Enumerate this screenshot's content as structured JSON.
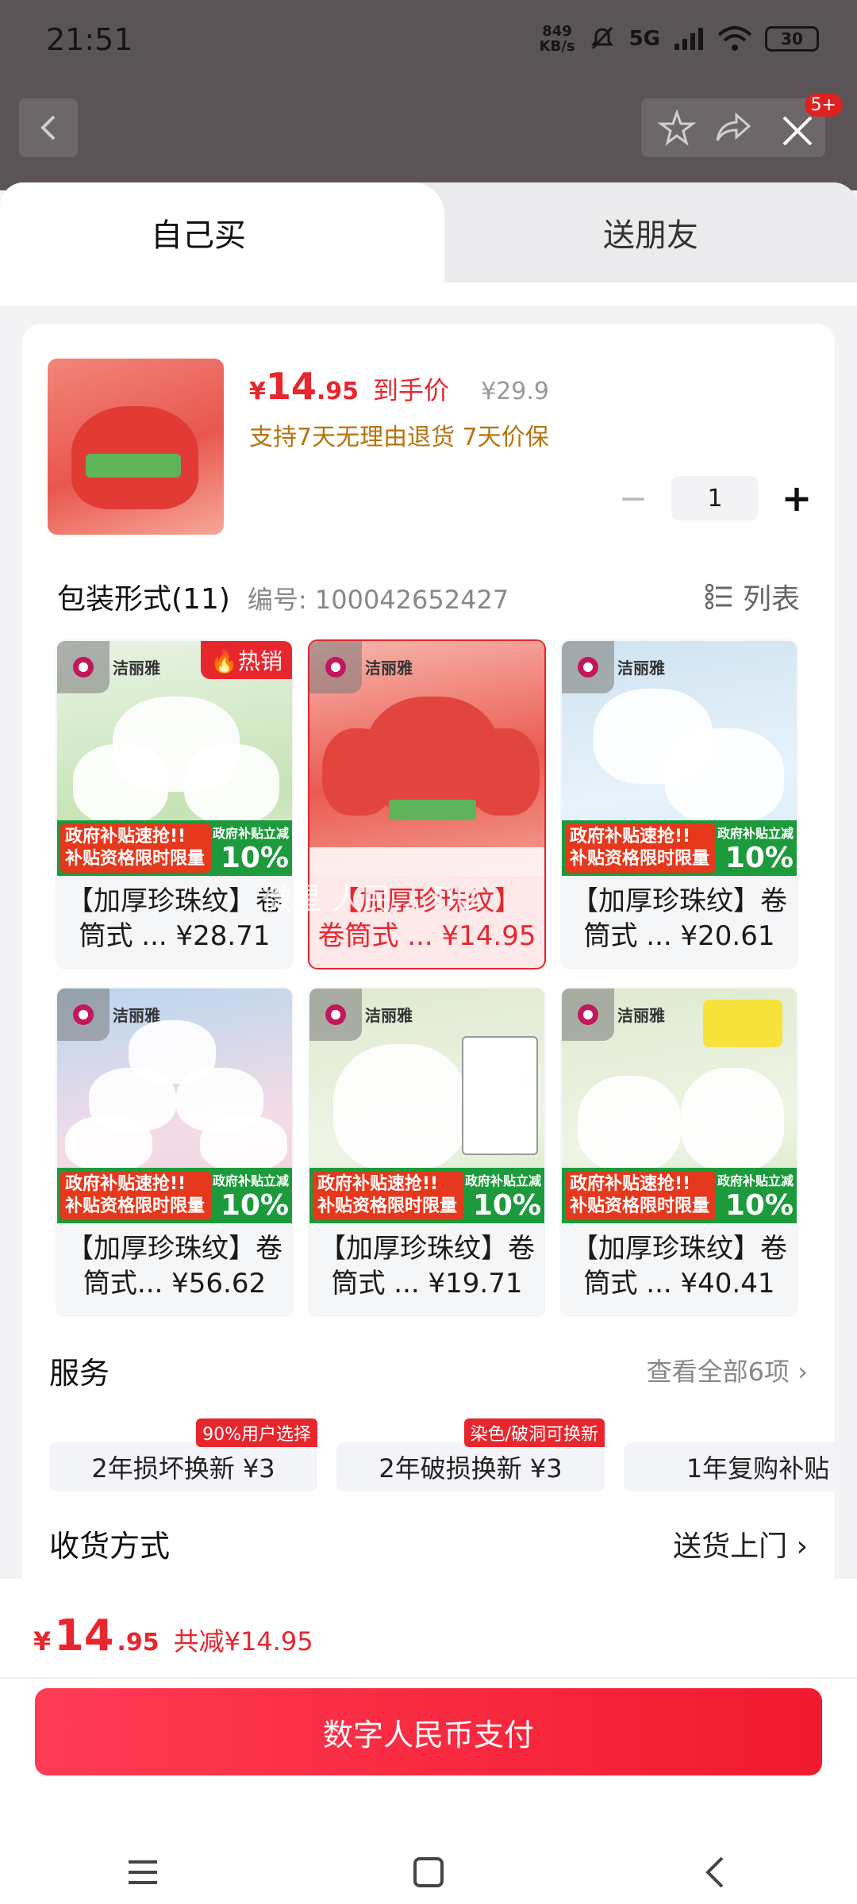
{
  "status": {
    "time": "21:51",
    "net_speed_value": "849",
    "net_speed_unit": "KB/s",
    "signal": "5G",
    "battery": "30"
  },
  "top_bar": {
    "notification_count": "5+"
  },
  "tabs": {
    "self_buy": "自己买",
    "gift_friend": "送朋友"
  },
  "product": {
    "price_symbol": "¥",
    "price_int": "14",
    "price_dec": ".95",
    "price_label": "到手价",
    "original_price": "¥29.9",
    "guarantee": "支持7天无理由退货  7天价保",
    "quantity": "1",
    "qty_minus": "−",
    "qty_plus": "+"
  },
  "packaging": {
    "title": "包装形式(11)",
    "code": "编号: 100042652427",
    "list_toggle": "列表",
    "brand": "洁丽雅",
    "promo_line1": "政府补贴速抢!!",
    "promo_line2": "补贴资格限时限量",
    "promo_right_label": "政府补贴立减",
    "promo_pct": "10%",
    "hot_badge": "热销",
    "items": [
      {
        "line1": "【加厚珍珠纹】卷",
        "line2": "筒式 ...",
        "price": "¥28.71"
      },
      {
        "line1": "【加厚珍珠纹】",
        "line2": "卷筒式 ...",
        "price": "¥14.95"
      },
      {
        "line1": "【加厚珍珠纹】卷",
        "line2": "筒式 ...",
        "price": "¥20.61"
      },
      {
        "line1": "【加厚珍珠纹】卷",
        "line2": "筒式...",
        "price": "¥56.62"
      },
      {
        "line1": "【加厚珍珠纹】卷",
        "line2": "筒式 ...",
        "price": "¥19.71"
      },
      {
        "line1": "【加厚珍珠纹】卷",
        "line2": "筒式 ...",
        "price": "¥40.41"
      }
    ]
  },
  "services": {
    "title": "服务",
    "view_all": "查看全部6项",
    "items": [
      {
        "label": "2年损坏换新  ¥3",
        "tag": "90%用户选择"
      },
      {
        "label": "2年破损换新  ¥3",
        "tag": "染色/破洞可换新"
      },
      {
        "label": "1年复购补贴",
        "tag": ""
      }
    ]
  },
  "delivery": {
    "title": "收货方式",
    "value": "送货上门"
  },
  "footer": {
    "total_symbol": "¥",
    "total_int": "14",
    "total_dec": ".95",
    "saving": "共减¥14.95",
    "pay_button": "数字人民币支付"
  },
  "colors": {
    "accent": "#e8262e",
    "gold": "#b8730f",
    "promo_green": "#1d9a3b"
  },
  "icons": [
    "back-icon",
    "star-icon",
    "share-icon",
    "close-icon",
    "list-icon",
    "fire-icon",
    "chevron-right-icon",
    "menu-icon",
    "home-icon",
    "nav-back-icon"
  ]
}
